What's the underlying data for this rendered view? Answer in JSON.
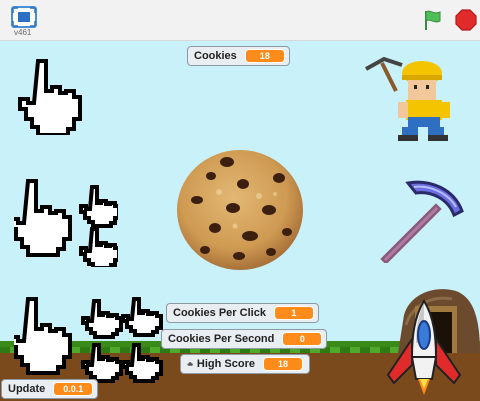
{
  "player": {
    "version": "v461",
    "fullscreen_icon": "fullscreen-icon",
    "green_flag_icon": "green-flag-icon",
    "stop_icon": "stop-icon",
    "flag_color": "#4cbf56",
    "stop_color": "#e02b2b"
  },
  "monitors": {
    "cookies": {
      "label": "Cookies",
      "value": "18"
    },
    "cookies_per_click": {
      "label": "Cookies Per Click",
      "value": "1"
    },
    "cookies_per_second": {
      "label": "Cookies Per Second",
      "value": "0"
    },
    "high_score": {
      "label": "High Score",
      "value": "18",
      "icon": "cloud-icon"
    },
    "update": {
      "label": "Update",
      "value": "0.0.1"
    }
  },
  "colors": {
    "sky": "#c9f1f9",
    "monitor_value": "#ff8c1a",
    "grass": "#3a8a1a",
    "dirt": "#7a4a1c"
  }
}
